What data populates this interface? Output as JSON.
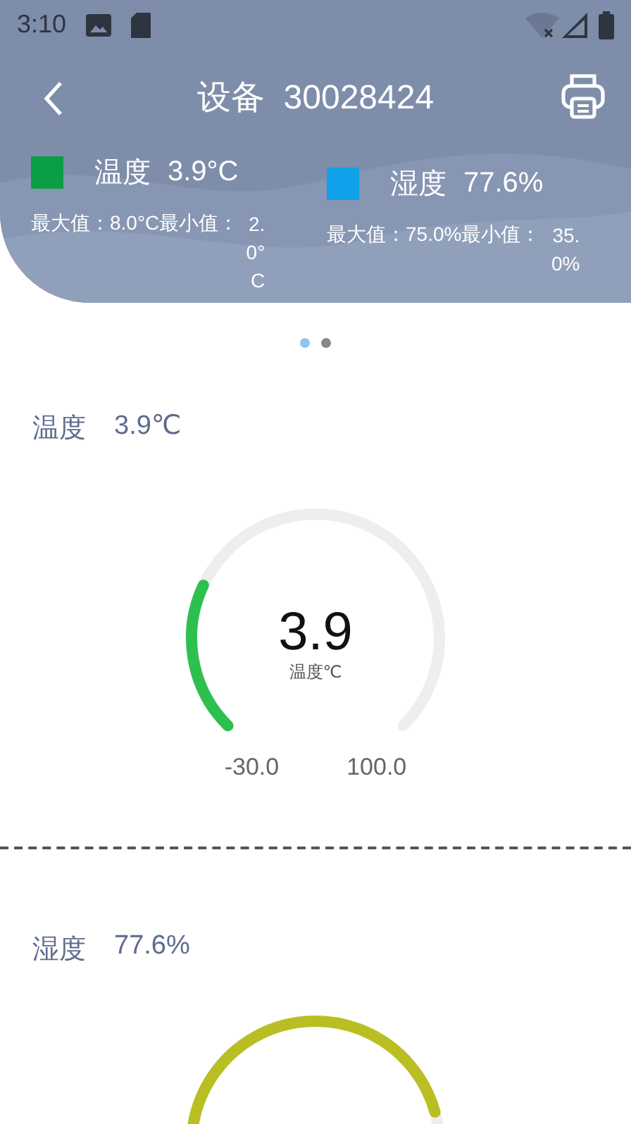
{
  "status_bar": {
    "time": "3:10"
  },
  "header": {
    "title": "设备  30028424"
  },
  "legend": [
    {
      "name": "温度",
      "value": "3.9°C",
      "color": "#0a9e45",
      "max_text": "最大值：8.0°C最小值：",
      "min_value": "2.0°C"
    },
    {
      "name": "湿度",
      "value": "77.6%",
      "color": "#11a0ea",
      "max_text": "最大值：75.0%最小值：",
      "min_value": "35.0%"
    }
  ],
  "pager": [
    {
      "selected": true
    },
    {
      "selected": false
    }
  ],
  "sections": [
    {
      "title": "温度",
      "value": "3.9℃",
      "gauge": {
        "color": "#2ec04f",
        "reading": "3.9",
        "unit": "温度℃",
        "min": "-30.0",
        "max": "100.0"
      }
    },
    {
      "title": "湿度",
      "value": "77.6%",
      "gauge": {
        "color": "#b9bf22"
      }
    }
  ]
}
